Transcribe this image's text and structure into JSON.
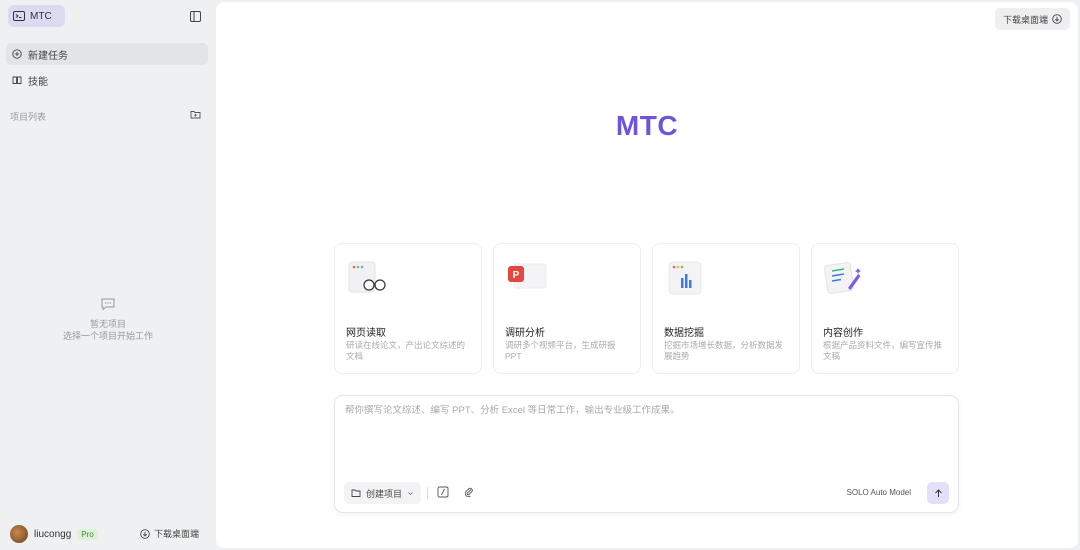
{
  "app": {
    "brand": "MTC",
    "brand_icon": "terminal-icon"
  },
  "sidebar": {
    "nav": [
      {
        "label": "新建任务",
        "icon": "chat-plus-icon",
        "active": true
      },
      {
        "label": "技能",
        "icon": "book-icon",
        "active": false
      }
    ],
    "section_label": "项目列表",
    "empty_title": "暂无项目",
    "empty_hint": "选择一个项目开始工作",
    "user": {
      "name": "liucongg",
      "badge": "Pro"
    },
    "download_label": "下载桌面端"
  },
  "main": {
    "download_label": "下载桌面端",
    "hero_title": "MTC",
    "cards": [
      {
        "title": "网页读取",
        "desc": "研读在线论文，产出论文综述的文档",
        "icon": "web-reader-icon"
      },
      {
        "title": "调研分析",
        "desc": "调研多个视频平台，生成研报PPT",
        "icon": "ppt-icon"
      },
      {
        "title": "数据挖掘",
        "desc": "挖掘市场增长数据，分析数据发展趋势",
        "icon": "bar-chart-icon"
      },
      {
        "title": "内容创作",
        "desc": "根据产品资料文件，编写宣传推文稿",
        "icon": "pen-document-icon"
      }
    ],
    "composer": {
      "placeholder": "帮你撰写论文综述、编写 PPT、分析 Excel 等日常工作，输出专业级工作成果。",
      "project_select": "创建项目",
      "model": "SOLO Auto Model"
    }
  },
  "colors": {
    "accent": "#6e55d8",
    "brand_bg": "#dcdaf3",
    "ppt_red": "#e2483d"
  }
}
